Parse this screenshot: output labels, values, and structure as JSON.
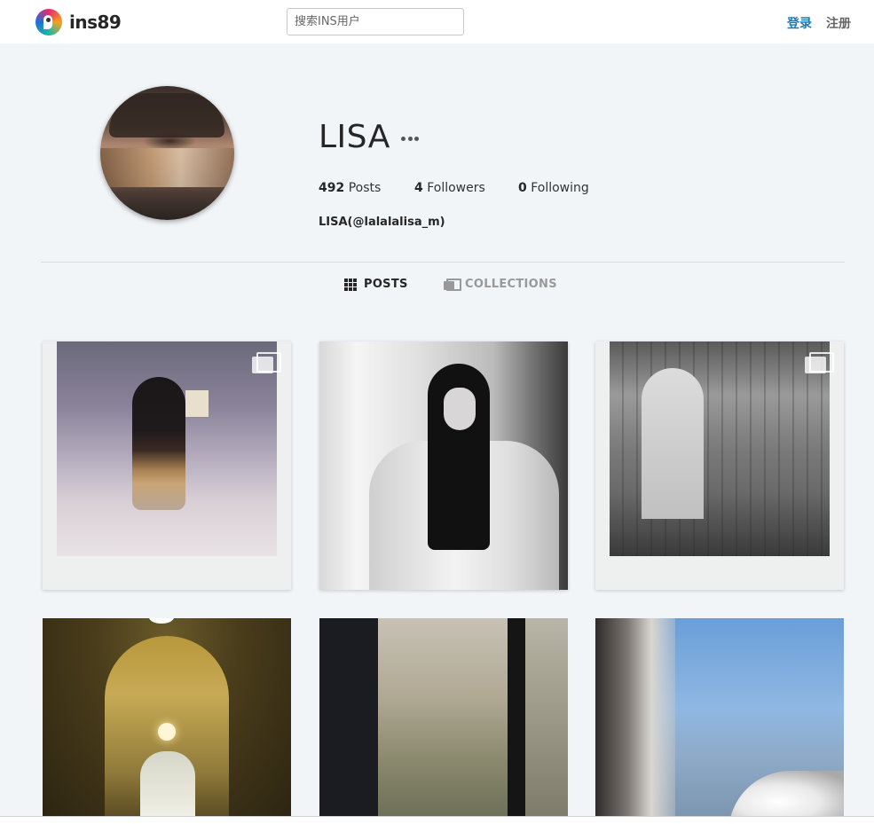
{
  "header": {
    "logo_text": "ins89",
    "search_placeholder": "搜索INS用户",
    "login_label": "登录",
    "register_label": "注册"
  },
  "profile": {
    "name": "LISA",
    "posts_count": "492",
    "posts_label": "Posts",
    "followers_count": "4",
    "followers_label": "Followers",
    "following_count": "0",
    "following_label": "Following",
    "fullname": "LISA(@lalalalisa_m)"
  },
  "tabs": [
    {
      "label": "POSTS",
      "icon": "grid-icon",
      "active": true
    },
    {
      "label": "COLLECTIONS",
      "icon": "collections-icon",
      "active": false
    }
  ],
  "posts": [
    {
      "multi": true
    },
    {
      "multi": false
    },
    {
      "multi": true
    },
    {
      "multi": false
    },
    {
      "multi": false
    },
    {
      "multi": false
    }
  ],
  "colors": {
    "accent": "#1d7ab9",
    "background": "#f1f5f8"
  }
}
